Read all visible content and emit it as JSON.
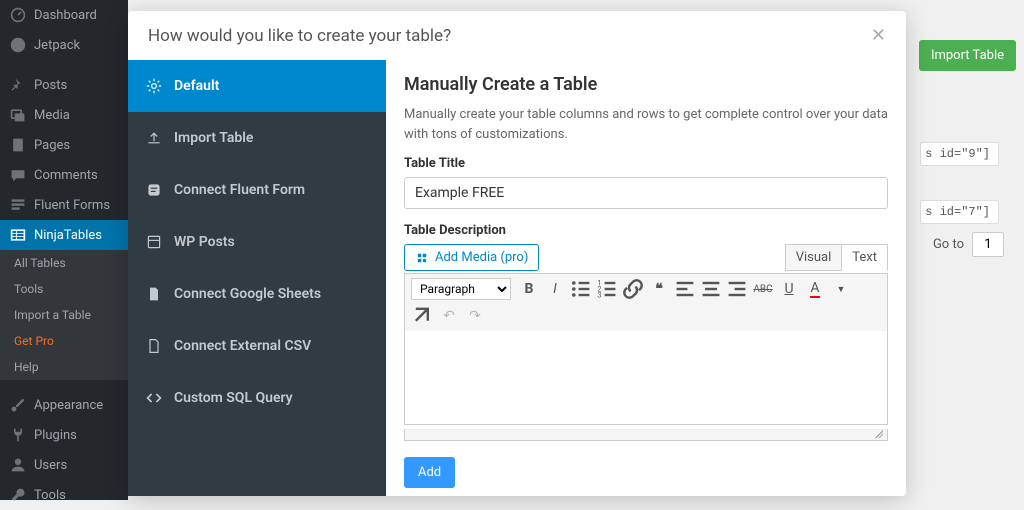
{
  "wp_sidebar": {
    "items": [
      {
        "label": "Dashboard"
      },
      {
        "label": "Jetpack"
      },
      {
        "label": "Posts"
      },
      {
        "label": "Media"
      },
      {
        "label": "Pages"
      },
      {
        "label": "Comments"
      },
      {
        "label": "Fluent Forms"
      },
      {
        "label": "NinjaTables"
      }
    ],
    "submenu": [
      {
        "label": "All Tables"
      },
      {
        "label": "Tools"
      },
      {
        "label": "Import a Table"
      },
      {
        "label": "Get Pro"
      },
      {
        "label": "Help"
      }
    ],
    "bottom_items": [
      {
        "label": "Appearance"
      },
      {
        "label": "Plugins"
      },
      {
        "label": "Users"
      },
      {
        "label": "Tools"
      }
    ]
  },
  "background": {
    "import_btn": "Import Table",
    "short1": "s id=\"9\"]",
    "short2": "s id=\"7\"]",
    "goto_label": "Go to",
    "goto_value": "1"
  },
  "modal": {
    "title": "How would you like to create your table?",
    "sidebar_items": [
      {
        "label": "Default"
      },
      {
        "label": "Import Table"
      },
      {
        "label": "Connect Fluent Form"
      },
      {
        "label": "WP Posts"
      },
      {
        "label": "Connect Google Sheets"
      },
      {
        "label": "Connect External CSV"
      },
      {
        "label": "Custom SQL Query"
      }
    ],
    "content": {
      "heading": "Manually Create a Table",
      "description": "Manually create your table columns and rows to get complete control over your data with tons of customizations.",
      "title_label": "Table Title",
      "title_value": "Example FREE",
      "desc_label": "Table Description",
      "add_media": "Add Media (pro)",
      "tab_visual": "Visual",
      "tab_text": "Text",
      "format_select": "Paragraph",
      "add_button": "Add"
    }
  }
}
